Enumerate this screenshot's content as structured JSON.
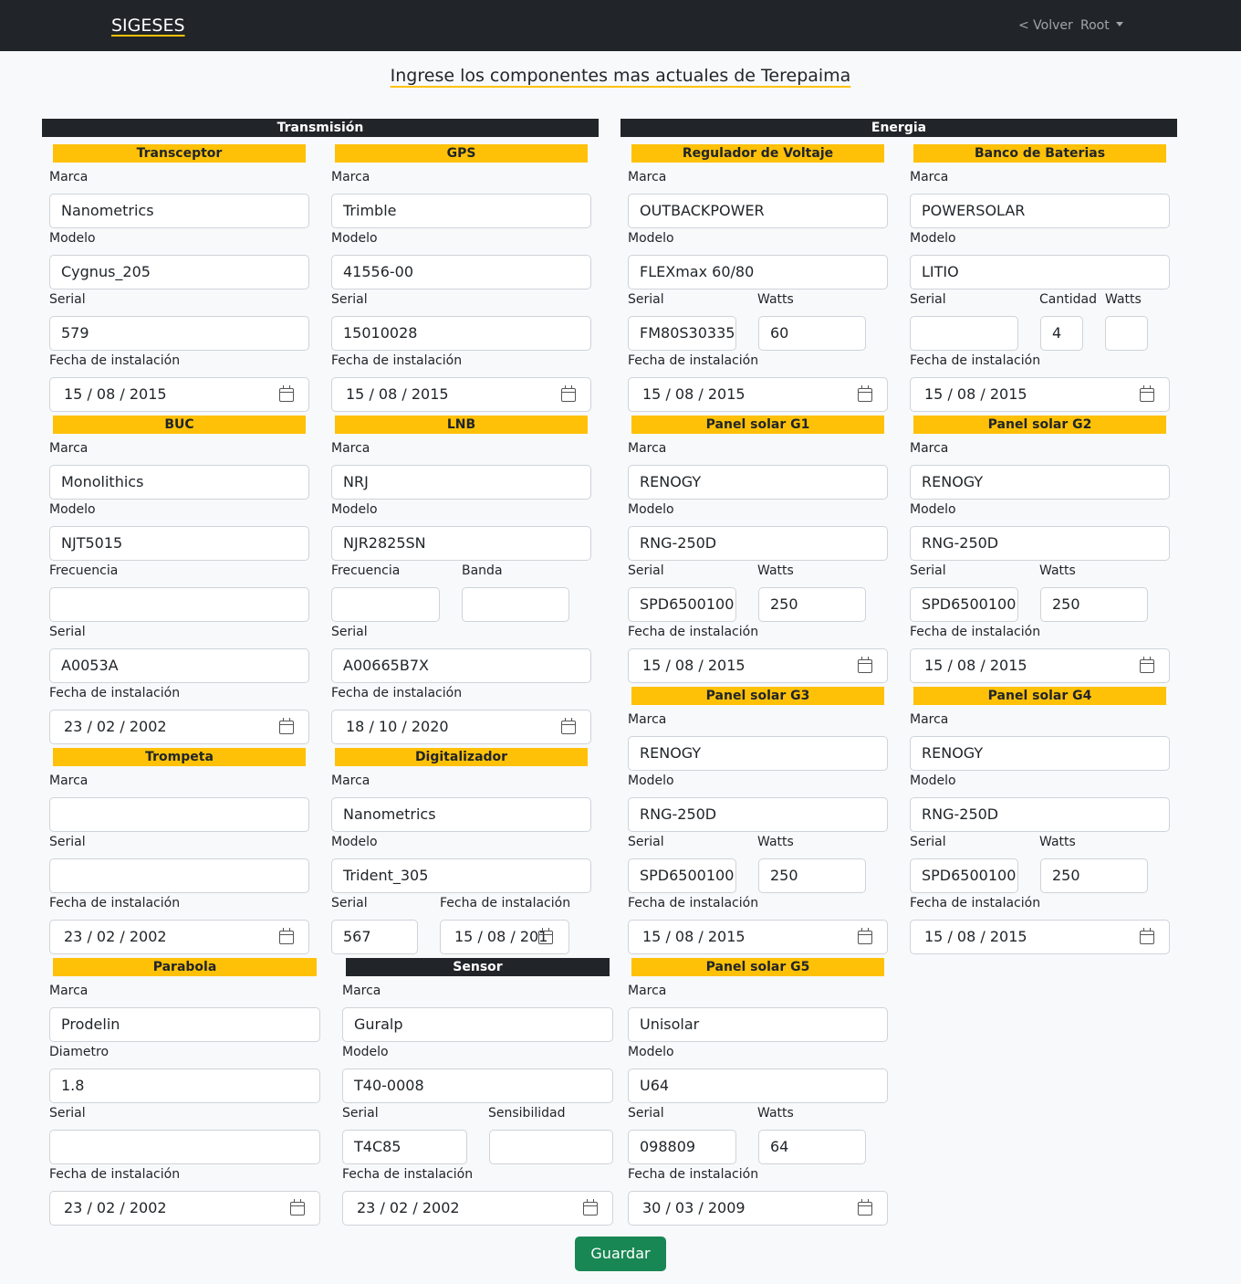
{
  "nav": {
    "brand": "SIGESES",
    "back": "< Volver",
    "user": "Root"
  },
  "title": "Ingrese los componentes mas actuales de Terepaima",
  "sections": {
    "transmision": "Transmisión",
    "energia": "Energia"
  },
  "boxes": {
    "transceptor": {
      "head": "Transceptor",
      "l_marca": "Marca",
      "marca": "Nanometrics",
      "l_modelo": "Modelo",
      "modelo": "Cygnus_205",
      "l_serial": "Serial",
      "serial": "579",
      "l_fecha": "Fecha de instalación",
      "fecha": "15 / 08 / 2015"
    },
    "gps": {
      "head": "GPS",
      "l_marca": "Marca",
      "marca": "Trimble",
      "l_modelo": "Modelo",
      "modelo": "41556-00",
      "l_serial": "Serial",
      "serial": "15010028",
      "l_fecha": "Fecha de instalación",
      "fecha": "15 / 08 / 2015"
    },
    "regulador": {
      "head": "Regulador de Voltaje",
      "l_marca": "Marca",
      "marca": "OUTBACKPOWER",
      "l_modelo": "Modelo",
      "modelo": "FLEXmax 60/80",
      "l_serial": "Serial",
      "serial": "FM80S30335",
      "l_watts": "Watts",
      "watts": "60",
      "l_fecha": "Fecha de instalación",
      "fecha": "15 / 08 / 2015"
    },
    "banco": {
      "head": "Banco de Baterias",
      "l_marca": "Marca",
      "marca": "POWERSOLAR",
      "l_modelo": "Modelo",
      "modelo": "LITIO",
      "l_serial": "Serial",
      "serial": "",
      "l_cantidad": "Cantidad",
      "cantidad": "4",
      "l_watts": "Watts",
      "watts": "",
      "l_fecha": "Fecha de instalación",
      "fecha": "15 / 08 / 2015"
    },
    "buc": {
      "head": "BUC",
      "l_marca": "Marca",
      "marca": "Monolithics",
      "l_modelo": "Modelo",
      "modelo": "NJT5015",
      "l_frecuencia": "Frecuencia",
      "frecuencia": "",
      "l_serial": "Serial",
      "serial": "A0053A",
      "l_fecha": "Fecha de instalación",
      "fecha": "23 / 02 / 2002"
    },
    "lnb": {
      "head": "LNB",
      "l_marca": "Marca",
      "marca": "NRJ",
      "l_modelo": "Modelo",
      "modelo": "NJR2825SN",
      "l_frecuencia": "Frecuencia",
      "frecuencia": "",
      "l_banda": "Banda",
      "banda": "",
      "l_serial": "Serial",
      "serial": "A00665B7X",
      "l_fecha": "Fecha de instalación",
      "fecha": "18 / 10 / 2020"
    },
    "g1": {
      "head": "Panel solar G1",
      "l_marca": "Marca",
      "marca": "RENOGY",
      "l_modelo": "Modelo",
      "modelo": "RNG-250D",
      "l_serial": "Serial",
      "serial": "SPD6500100",
      "l_watts": "Watts",
      "watts": "250",
      "l_fecha": "Fecha de instalación",
      "fecha": "15 / 08 / 2015"
    },
    "g2": {
      "head": "Panel solar G2",
      "l_marca": "Marca",
      "marca": "RENOGY",
      "l_modelo": "Modelo",
      "modelo": "RNG-250D",
      "l_serial": "Serial",
      "serial": "SPD6500100",
      "l_watts": "Watts",
      "watts": "250",
      "l_fecha": "Fecha de instalación",
      "fecha": "15 / 08 / 2015"
    },
    "trompeta": {
      "head": "Trompeta",
      "l_marca": "Marca",
      "marca": "",
      "l_serial": "Serial",
      "serial": "",
      "l_fecha": "Fecha de instalación",
      "fecha": "23 / 02 / 2002"
    },
    "digitalizador": {
      "head": "Digitalizador",
      "l_marca": "Marca",
      "marca": "Nanometrics",
      "l_modelo": "Modelo",
      "modelo": "Trident_305",
      "l_serial": "Serial",
      "serial": "567",
      "l_fecha": "Fecha de instalación",
      "fecha": "15 / 08 / 201"
    },
    "g3": {
      "head": "Panel solar G3",
      "l_marca": "Marca",
      "marca": "RENOGY",
      "l_modelo": "Modelo",
      "modelo": "RNG-250D",
      "l_serial": "Serial",
      "serial": "SPD6500100",
      "l_watts": "Watts",
      "watts": "250",
      "l_fecha": "Fecha de instalación",
      "fecha": "15 / 08 / 2015"
    },
    "g4": {
      "head": "Panel solar G4",
      "l_marca": "Marca",
      "marca": "RENOGY",
      "l_modelo": "Modelo",
      "modelo": "RNG-250D",
      "l_serial": "Serial",
      "serial": "SPD6500100",
      "l_watts": "Watts",
      "watts": "250",
      "l_fecha": "Fecha de instalación",
      "fecha": "15 / 08 / 2015"
    },
    "parabola": {
      "head": "Parabola",
      "l_marca": "Marca",
      "marca": "Prodelin",
      "l_diametro": "Diametro",
      "diametro": "1.8",
      "l_serial": "Serial",
      "serial": "",
      "l_fecha": "Fecha de instalación",
      "fecha": "23 / 02 / 2002"
    },
    "sensor": {
      "head": "Sensor",
      "l_marca": "Marca",
      "marca": "Guralp",
      "l_modelo": "Modelo",
      "modelo": "T40-0008",
      "l_serial": "Serial",
      "serial": "T4C85",
      "l_sensibilidad": "Sensibilidad",
      "sensibilidad": "",
      "l_fecha": "Fecha de instalación",
      "fecha": "23 / 02 / 2002"
    },
    "g5": {
      "head": "Panel solar G5",
      "l_marca": "Marca",
      "marca": "Unisolar",
      "l_modelo": "Modelo",
      "modelo": "U64",
      "l_serial": "Serial",
      "serial": "098809",
      "l_watts": "Watts",
      "watts": "64",
      "l_fecha": "Fecha de instalación",
      "fecha": "30 / 03 / 2009"
    }
  },
  "actions": {
    "save": "Guardar"
  }
}
